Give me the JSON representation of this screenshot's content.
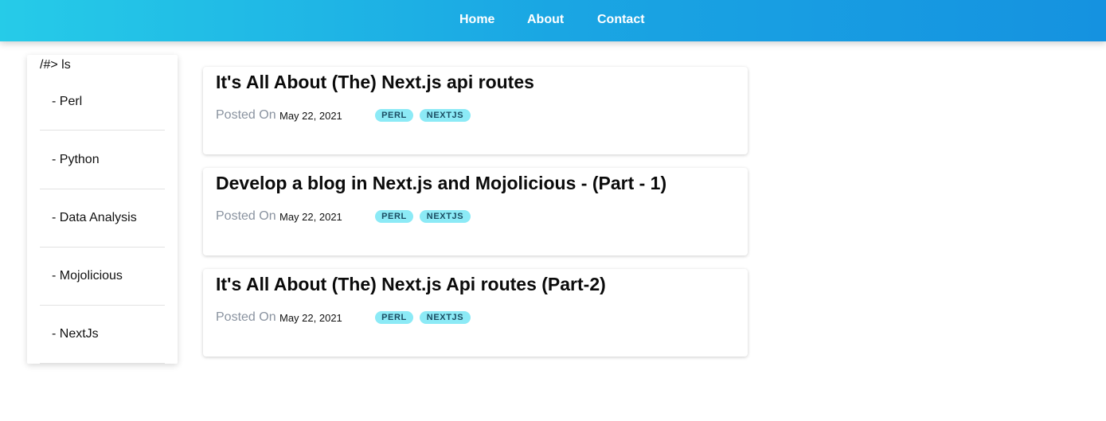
{
  "nav": {
    "links": [
      "Home",
      "About",
      "Contact"
    ]
  },
  "sidebar": {
    "prompt": "/#> ls",
    "items": [
      {
        "label": "- Perl"
      },
      {
        "label": "- Python"
      },
      {
        "label": "- Data Analysis"
      },
      {
        "label": "- Mojolicious"
      },
      {
        "label": "- NextJs"
      }
    ]
  },
  "posts": [
    {
      "title": "It's All About (The) Next.js api routes",
      "posted_label": "Posted On",
      "date": "May 22, 2021",
      "tags": [
        "PERL",
        "NEXTJS"
      ]
    },
    {
      "title": "Develop a blog in Next.js and Mojolicious - (Part - 1)",
      "posted_label": "Posted On",
      "date": "May 22, 2021",
      "tags": [
        "PERL",
        "NEXTJS"
      ]
    },
    {
      "title": "It's All About (The) Next.js Api routes (Part-2)",
      "posted_label": "Posted On",
      "date": "May 22, 2021",
      "tags": [
        "PERL",
        "NEXTJS"
      ]
    }
  ],
  "colors": {
    "header_gradient_start": "#26cbe8",
    "header_gradient_end": "#1592e0",
    "tag_background": "#8ceaf6",
    "tag_text": "#1b4d63",
    "muted_text": "#8a93a0"
  }
}
